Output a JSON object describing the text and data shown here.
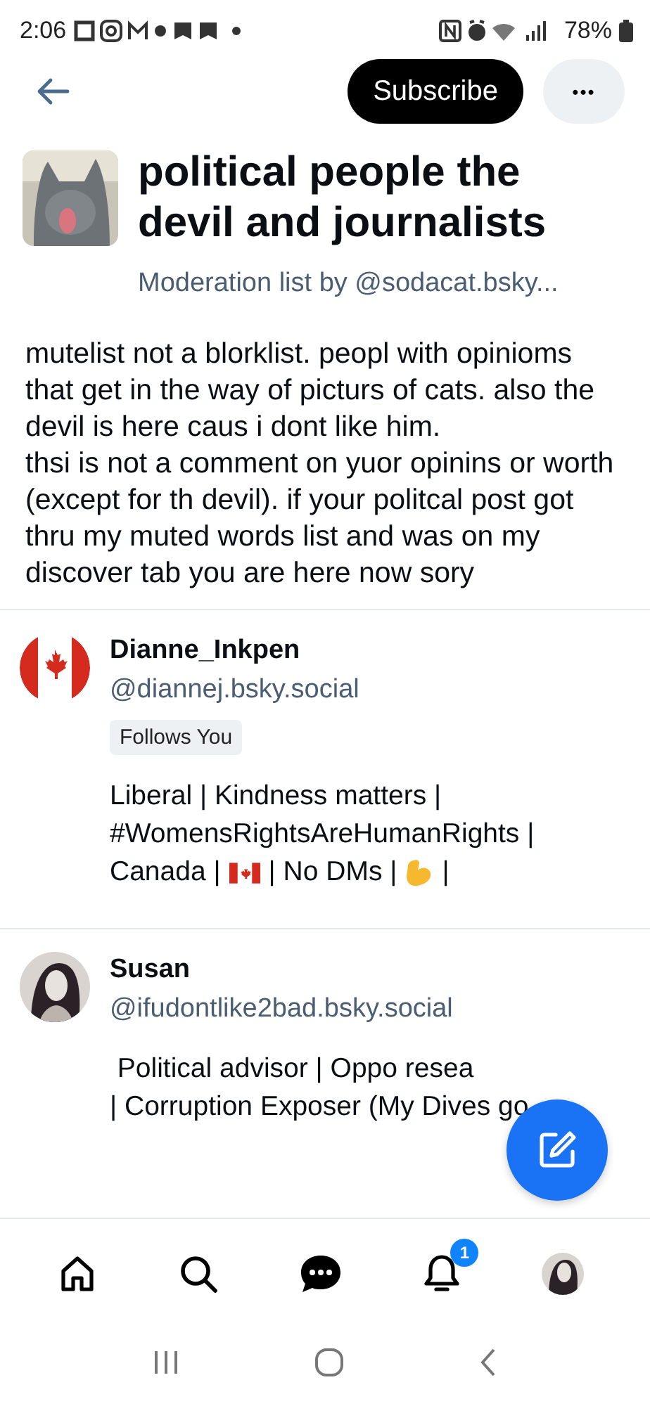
{
  "status_bar": {
    "time": "2:06",
    "battery": "78%"
  },
  "header": {
    "subscribe_label": "Subscribe",
    "more_label": "•••"
  },
  "list": {
    "title": "political people the devil and journalists",
    "subtitle": "Moderation list by @sodacat.bsky...",
    "description": "mutelist not a blorklist. peopl with opinioms that get in the way of picturs of cats. also the devil is here caus i dont like him.\nthsi is not a comment on yuor opinins or worth (except for th devil). if your politcal post got thru my muted words list and was on my discover tab you are here now sory"
  },
  "members": [
    {
      "name": "Dianne_Inkpen",
      "handle": "@diannej.bsky.social",
      "avatar": {
        "kind": "flag"
      },
      "follows_you": "Follows You",
      "bio": [
        [
          {
            "kind": "text",
            "text": "Liberal | Kindness matters |"
          }
        ],
        [
          {
            "kind": "text",
            "text": "#WomensRightsAreHumanRights |"
          }
        ],
        [
          {
            "kind": "text",
            "text": "Canada |"
          },
          {
            "kind": "flag"
          },
          {
            "kind": "text",
            "text": "| No DMs |"
          },
          {
            "kind": "arm"
          },
          {
            "kind": "text",
            "text": "|"
          }
        ]
      ]
    },
    {
      "name": "Susan",
      "handle": "@ifudontlike2bad.bsky.social",
      "avatar": {
        "kind": "person"
      },
      "bio": [
        [
          {
            "kind": "text",
            "text": " Political advisor | Oppo resea"
          }
        ],
        [
          {
            "kind": "text",
            "text": "| Corruption Exposer (My Dives go"
          }
        ]
      ]
    }
  ],
  "bottom_nav": [
    {
      "kind": "home"
    },
    {
      "kind": "search"
    },
    {
      "kind": "chat"
    },
    {
      "kind": "bell",
      "badge": "1"
    },
    {
      "kind": "avatar"
    }
  ]
}
